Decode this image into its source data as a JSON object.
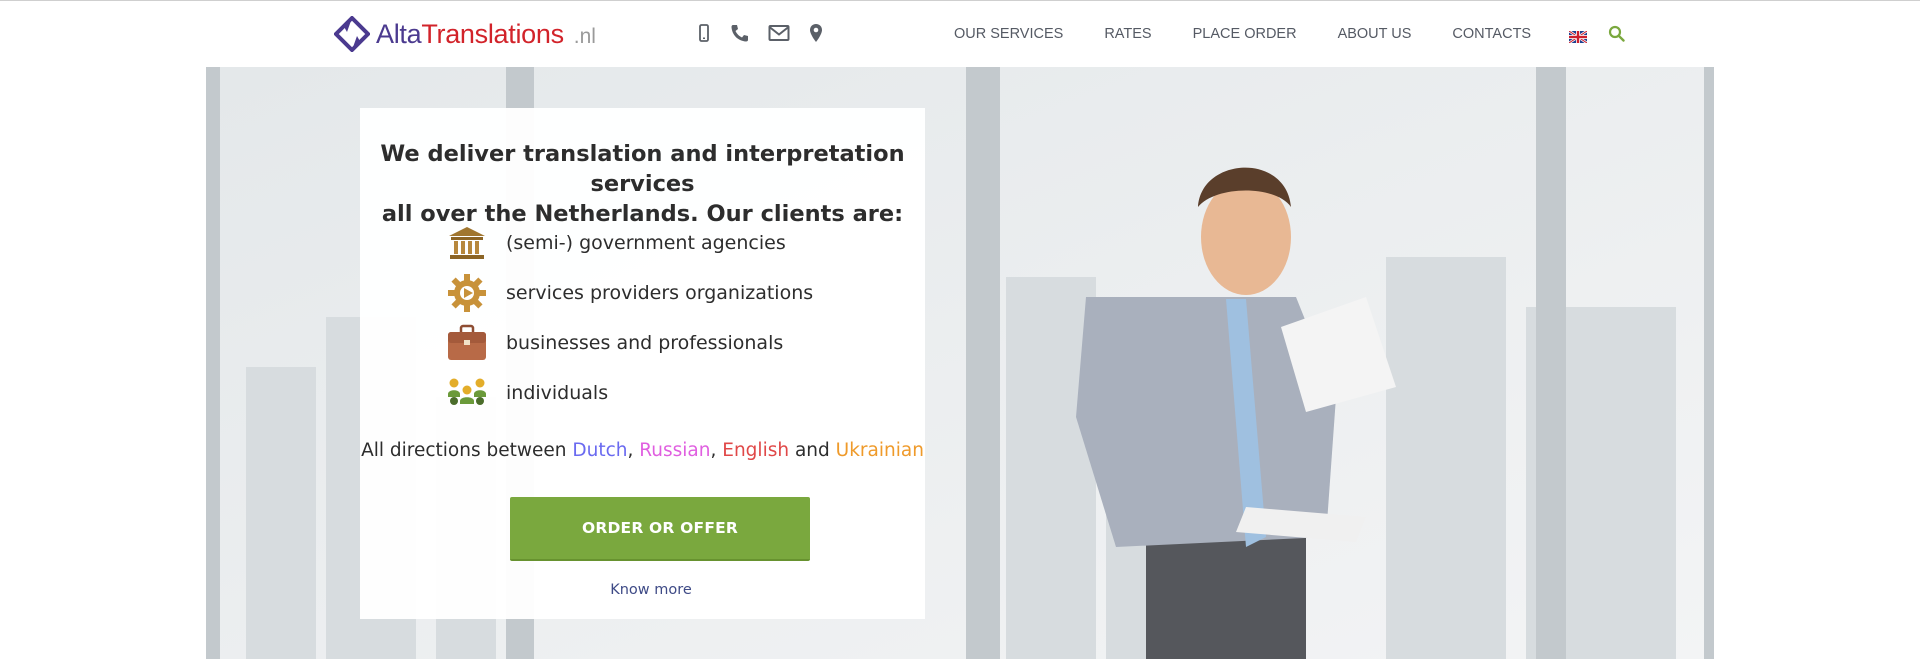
{
  "brand": {
    "name_part1": "Alta",
    "name_part2": "Translations",
    "tld": ".nl",
    "colors": {
      "primary": "#4b3a8f",
      "accent": "#d2232a",
      "tld": "#9a9a9a"
    }
  },
  "contact_icons": [
    "mobile-phone-icon",
    "phone-icon",
    "envelope-icon",
    "map-marker-icon"
  ],
  "nav": {
    "items": [
      {
        "label": "OUR SERVICES"
      },
      {
        "label": "RATES"
      },
      {
        "label": "PLACE ORDER"
      },
      {
        "label": "ABOUT US"
      },
      {
        "label": "CONTACTS"
      }
    ],
    "language_flag": "uk-flag-icon",
    "search_icon": "search-icon"
  },
  "hero": {
    "heading_line1": "We deliver translation and interpretation services",
    "heading_line2": "all over the Netherlands. Our clients are:",
    "clients": [
      {
        "icon": "government-building-icon",
        "label": "(semi-) government agencies"
      },
      {
        "icon": "gear-icon",
        "label": "services providers organizations"
      },
      {
        "icon": "briefcase-icon",
        "label": "businesses and professionals"
      },
      {
        "icon": "people-icon",
        "label": "individuals"
      }
    ],
    "directions": {
      "prefix": "All directions between ",
      "lang1": "Dutch",
      "sep1": ", ",
      "lang2": "Russian",
      "sep2": ", ",
      "lang3": "English",
      "sep3": " and ",
      "lang4": "Ukrainian"
    },
    "cta_label": "ORDER OR OFFER",
    "know_more": "Know more",
    "colors": {
      "cta": "#7aa83e",
      "dutch": "#6a6af0",
      "russian": "#e05fe0",
      "english": "#e04848",
      "ukrainian": "#ef9a2a"
    }
  }
}
